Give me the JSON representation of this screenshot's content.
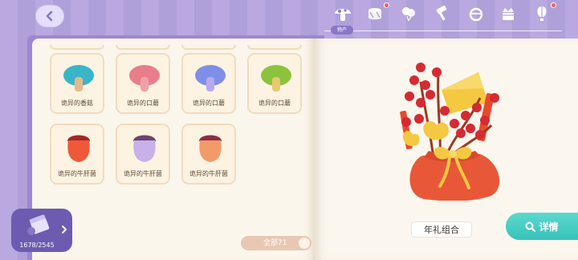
{
  "nav": {
    "tabs": [
      {
        "icon": "mushroom-icon",
        "active": true,
        "label": "物产",
        "dot": false
      },
      {
        "icon": "drum-icon",
        "active": false,
        "dot": true
      },
      {
        "icon": "balloon-icon",
        "active": false,
        "dot": false
      },
      {
        "icon": "hammer-icon",
        "active": false,
        "dot": false
      },
      {
        "icon": "ring-icon",
        "active": false,
        "dot": false
      },
      {
        "icon": "crown-box-icon",
        "active": false,
        "dot": false
      },
      {
        "icon": "hot-air-balloon-icon",
        "active": false,
        "dot": true
      }
    ]
  },
  "items": [
    {
      "name": "诡异的香菇",
      "cap": "#3ab5c8",
      "stem": "#e8b888"
    },
    {
      "name": "诡异的口蘑",
      "cap": "#e87e8a",
      "stem": "#f2a0a8"
    },
    {
      "name": "诡异的口蘑",
      "cap": "#7e8fe8",
      "stem": "#b8a8f0"
    },
    {
      "name": "诡异的口蘑",
      "cap": "#8bc43c",
      "stem": "#e8c870"
    },
    {
      "name": "诡异的牛肝菌",
      "cap": "#a02828",
      "stem": "#f0583a"
    },
    {
      "name": "诡异的牛肝菌",
      "cap": "#6a4470",
      "stem": "#c8b0e8"
    },
    {
      "name": "诡异的牛肝菌",
      "cap": "#8a3048",
      "stem": "#f39a6a"
    }
  ],
  "filter": {
    "label": "全部71"
  },
  "currency": {
    "amount": "1678/2545"
  },
  "selected": {
    "name": "年礼组合",
    "detail_label": "详情"
  },
  "colors": {
    "accent": "#38c2b8",
    "purple": "#6c5bb0",
    "card_border": "#f0dcbf"
  }
}
